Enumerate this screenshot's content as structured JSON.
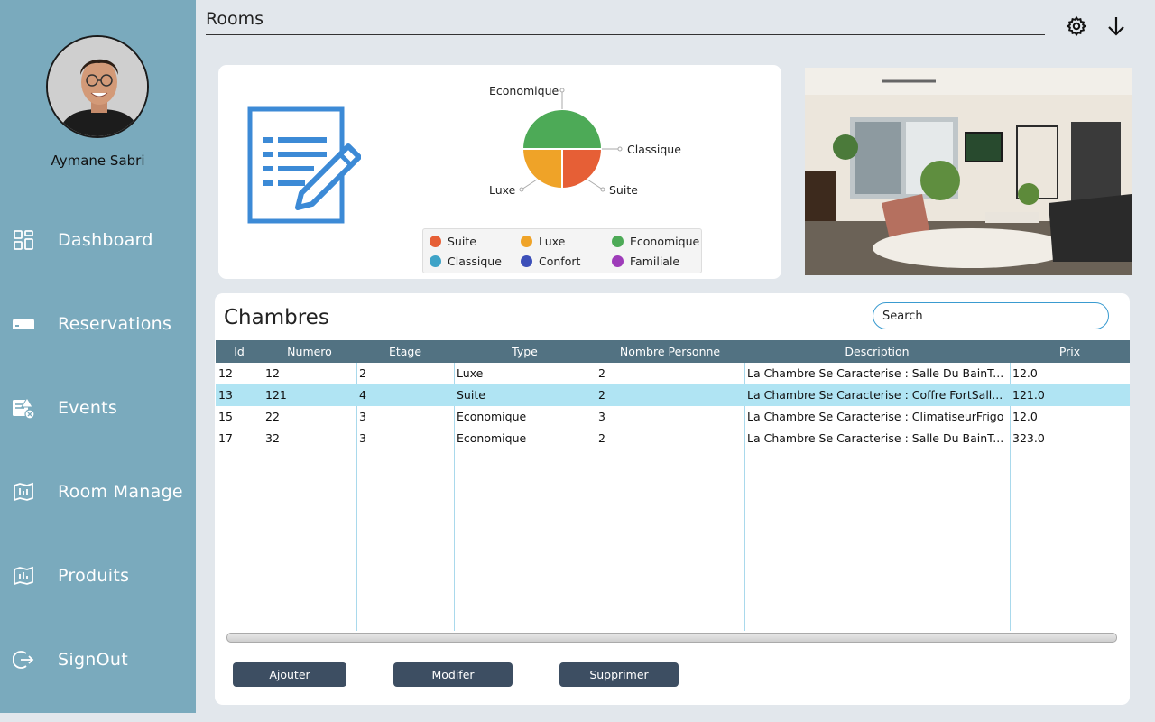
{
  "user": {
    "name": "Aymane Sabri"
  },
  "nav": {
    "items": [
      {
        "label": "Dashboard",
        "icon": "dashboard-icon"
      },
      {
        "label": "Reservations",
        "icon": "reservation-icon"
      },
      {
        "label": "Events",
        "icon": "events-icon"
      },
      {
        "label": "Room Manage",
        "icon": "room-manage-icon"
      },
      {
        "label": "Produits",
        "icon": "produits-icon"
      },
      {
        "label": "SignOut",
        "icon": "signout-icon"
      }
    ]
  },
  "header": {
    "title": "Rooms",
    "actions": [
      "gear-icon",
      "download-arrow-icon"
    ]
  },
  "chart_data": {
    "type": "pie",
    "title": "",
    "slices": [
      {
        "label": "Economique",
        "value": 50,
        "color": "#4daa57"
      },
      {
        "label": "Suite",
        "value": 25,
        "color": "#e65f36"
      },
      {
        "label": "Luxe",
        "value": 25,
        "color": "#efa328"
      }
    ],
    "annotations": [
      "Economique",
      "Classique",
      "Luxe",
      "Suite"
    ],
    "legend": {
      "position": "bottom",
      "entries": [
        {
          "label": "Suite",
          "color": "#e65f36"
        },
        {
          "label": "Luxe",
          "color": "#efa328"
        },
        {
          "label": "Economique",
          "color": "#4daa57"
        },
        {
          "label": "Classique",
          "color": "#3ea3c7"
        },
        {
          "label": "Confort",
          "color": "#3c4fb9"
        },
        {
          "label": "Familiale",
          "color": "#9e3cb9"
        }
      ]
    }
  },
  "chambres": {
    "title": "Chambres",
    "search_placeholder": "Search",
    "columns": [
      "Id",
      "Numero",
      "Etage",
      "Type",
      "Nombre Personne",
      "Description",
      "Prix"
    ],
    "rows": [
      [
        "12",
        "12",
        "2",
        "Luxe",
        "2",
        "La Chambre Se Caracterise : Salle Du BainT...",
        "12.0"
      ],
      [
        "13",
        "121",
        "4",
        "Suite",
        "2",
        "La Chambre Se Caracterise : Coffre FortSall...",
        "121.0"
      ],
      [
        "15",
        "22",
        "3",
        "Economique",
        "3",
        "La Chambre Se Caracterise : ClimatiseurFrigo",
        "12.0"
      ],
      [
        "17",
        "32",
        "3",
        "Economique",
        "2",
        "La Chambre Se Caracterise : Salle Du BainT...",
        "323.0"
      ]
    ],
    "selected_row": 1
  },
  "actions": {
    "add_label": "Ajouter",
    "edit_label": "Modifer",
    "delete_label": "Supprimer"
  },
  "colors": {
    "sidebar": "#7aaabd",
    "table_header": "#527282",
    "selected_row": "#b0e4f3",
    "button": "#3d4e62"
  }
}
